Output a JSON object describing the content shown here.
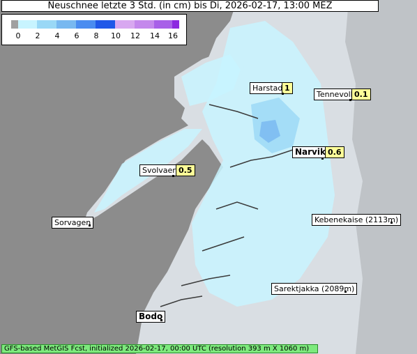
{
  "title": "Neuschnee letzte 3 Std. (in cm) bis Di, 2026-02-17, 13:00 MEZ",
  "legend": {
    "ticks": [
      "0",
      "2",
      "4",
      "6",
      "8",
      "10",
      "12",
      "14",
      "16"
    ],
    "colors": [
      "#a0a0a0",
      "#c8f4ff",
      "#9ad8f6",
      "#78b8f0",
      "#4a8cf0",
      "#2058e8",
      "#d8a8f0",
      "#c488ec",
      "#a860e8",
      "#8c28e0"
    ]
  },
  "places": {
    "harstad": {
      "name": "Harstad",
      "value": "1"
    },
    "tennevoll": {
      "name": "Tennevoll",
      "value": "0.1"
    },
    "narvik": {
      "name": "Narvik",
      "value": "0.6"
    },
    "svolvaer": {
      "name": "Svolvaer",
      "value": "0.5"
    },
    "sorvagen": {
      "name": "Sorvagen"
    },
    "kebnekaise": {
      "name": "Kebenekaise (2113m)"
    },
    "sarektjakka": {
      "name": "Sarektjakka (2089m)"
    },
    "bodo": {
      "name": "Bodo"
    }
  },
  "footer": "GFS-based MetGIS Fcst, initialized 2026-02-17, 00:00 UTC  (resolution 393 m X 1060 m)"
}
